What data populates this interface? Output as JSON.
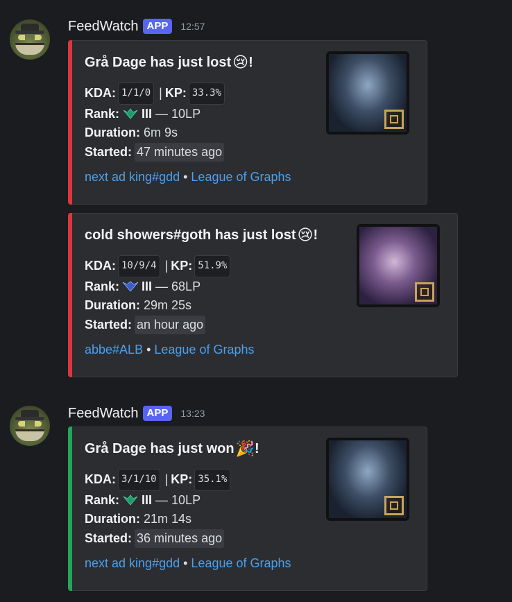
{
  "messages": [
    {
      "username": "FeedWatch",
      "badge": "APP",
      "timestamp": "12:57",
      "embeds": [
        {
          "color": "#da373c",
          "title": "Grå Dage has just lost",
          "title_emoji": "😢",
          "title_suffix": "!",
          "kda_label": "KDA:",
          "kda": "1/1/0",
          "kp_label": "KP:",
          "kp": "33.3%",
          "rank_label": "Rank:",
          "rank_icon": "emerald-rank-icon",
          "rank_tier": "III",
          "rank_lp": "— 10LP",
          "duration_label": "Duration:",
          "duration": "6m 9s",
          "started_label": "Started:",
          "started": "47 minutes ago",
          "footer_link": "next ad king#gdd",
          "footer_source": "League of Graphs",
          "thumbnail": "champion-portrait-armored"
        },
        {
          "color": "#da373c",
          "title": "cold showers#goth has just lost",
          "title_emoji": "😢",
          "title_suffix": "!",
          "kda_label": "KDA:",
          "kda": "10/9/4",
          "kp_label": "KP:",
          "kp": "51.9%",
          "rank_label": "Rank:",
          "rank_icon": "diamond-rank-icon",
          "rank_tier": "III",
          "rank_lp": "— 68LP",
          "duration_label": "Duration:",
          "duration": "29m 25s",
          "started_label": "Started:",
          "started": "an hour ago",
          "footer_link": "abbe#ALB",
          "footer_source": "League of Graphs",
          "thumbnail": "champion-portrait-violet"
        }
      ]
    },
    {
      "username": "FeedWatch",
      "badge": "APP",
      "timestamp": "13:23",
      "embeds": [
        {
          "color": "#23a55a",
          "title": "Grå Dage has just won",
          "title_emoji": "🎉",
          "title_suffix": "!",
          "kda_label": "KDA:",
          "kda": "3/1/10",
          "kp_label": "KP:",
          "kp": "35.1%",
          "rank_label": "Rank:",
          "rank_icon": "emerald-rank-icon",
          "rank_tier": "III",
          "rank_lp": "— 10LP",
          "duration_label": "Duration:",
          "duration": "21m 14s",
          "started_label": "Started:",
          "started": "36 minutes ago",
          "footer_link": "next ad king#gdd",
          "footer_source": "League of Graphs",
          "thumbnail": "champion-portrait-armored"
        }
      ]
    }
  ]
}
